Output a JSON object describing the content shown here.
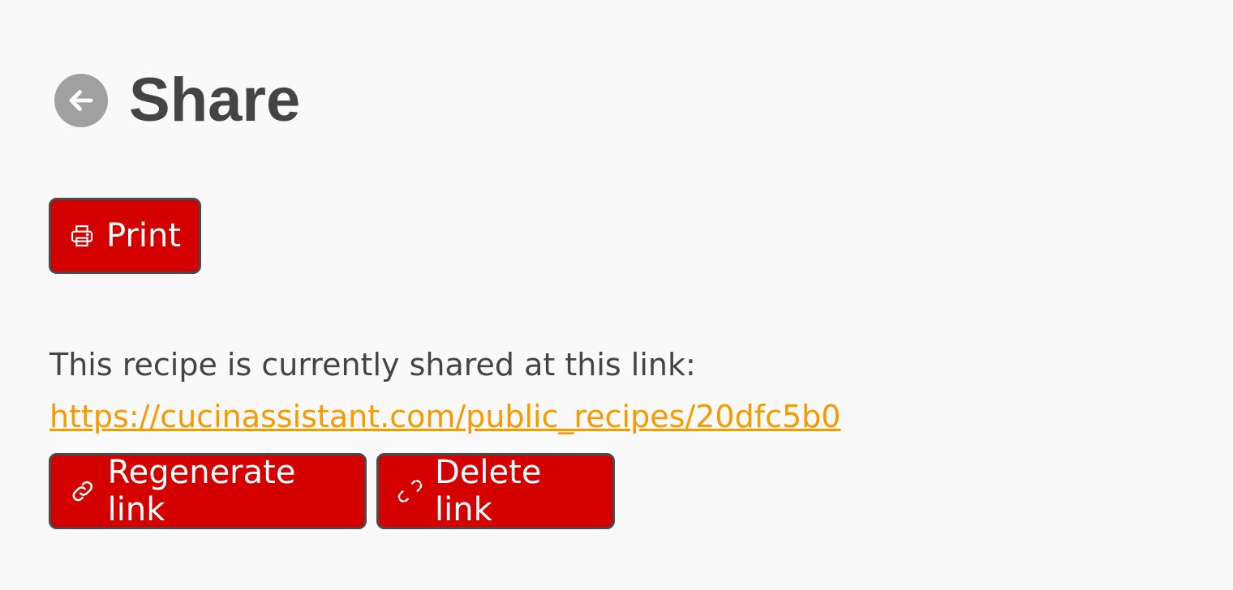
{
  "header": {
    "title": "Share",
    "back_icon": "arrow-left-icon"
  },
  "buttons": {
    "print": "Print",
    "regenerate": "Regenerate link",
    "delete": "Delete link"
  },
  "share": {
    "text": "This recipe is currently shared at this link:",
    "url": "https://cucinassistant.com/public_recipes/20dfc5b0"
  },
  "colors": {
    "button": "#d40000",
    "link": "#f59a00"
  }
}
